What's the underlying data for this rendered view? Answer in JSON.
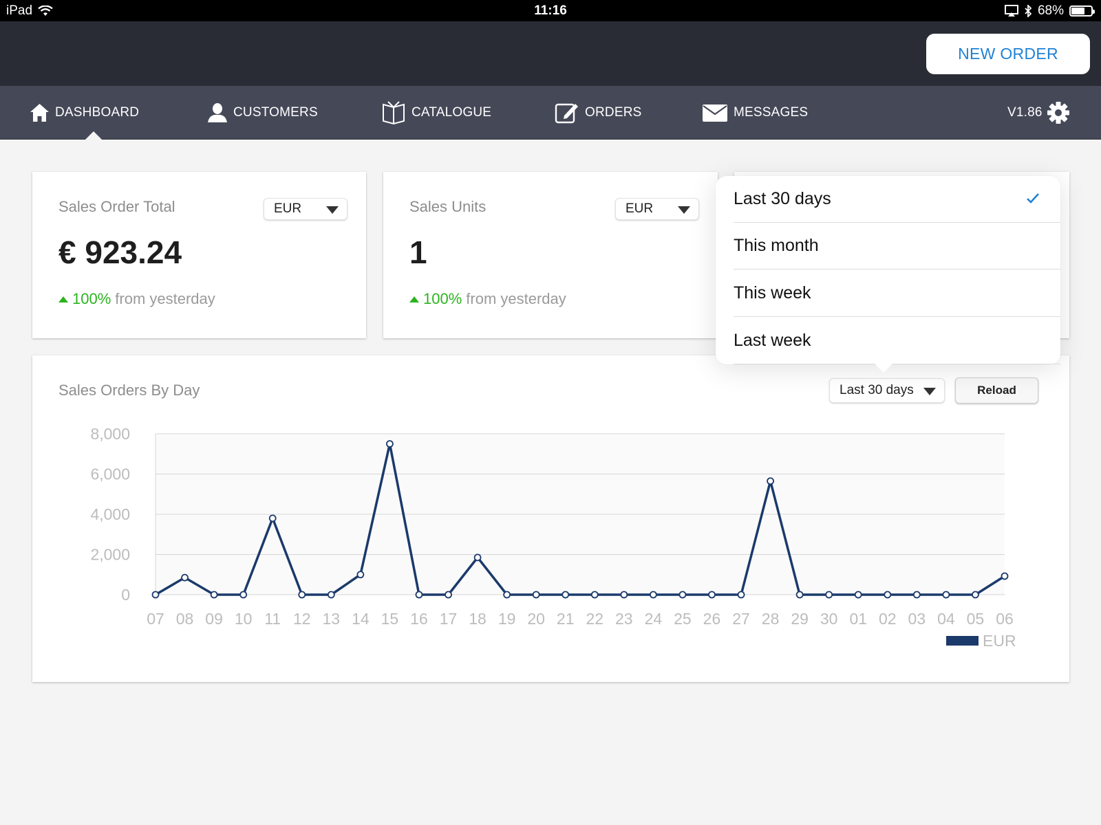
{
  "status_bar": {
    "device": "iPad",
    "time": "11:16",
    "battery": "68%",
    "battery_level": 0.68
  },
  "header": {
    "new_order_label": "NEW ORDER"
  },
  "nav": {
    "items": [
      {
        "label": "DASHBOARD",
        "icon": "home-icon"
      },
      {
        "label": "CUSTOMERS",
        "icon": "user-icon"
      },
      {
        "label": "CATALOGUE",
        "icon": "book-icon"
      },
      {
        "label": "ORDERS",
        "icon": "edit-icon"
      },
      {
        "label": "MESSAGES",
        "icon": "envelope-icon"
      }
    ],
    "version": "V1.86",
    "settings_icon": "gear-icon"
  },
  "cards": [
    {
      "title": "Sales Order Total",
      "currency": "EUR",
      "value": "€ 923.24",
      "change_pct": "100%",
      "change_text": "from yesterday"
    },
    {
      "title": "Sales Units",
      "currency": "EUR",
      "value": "1",
      "change_pct": "100%",
      "change_text": "from yesterday"
    }
  ],
  "chart_panel": {
    "title": "Sales Orders By Day",
    "range_select": "Last 30 days",
    "reload_label": "Reload"
  },
  "dropdown": {
    "options": [
      "Last 30 days",
      "This month",
      "This week",
      "Last week"
    ],
    "selected": "Last 30 days"
  },
  "colors": {
    "accent": "#1f82d6",
    "positive": "#2bb31e",
    "series": "#1b3a6b",
    "nav_bg": "#454857",
    "header_bg": "#2a2c35"
  },
  "chart_data": {
    "type": "line",
    "title": "Sales Orders By Day",
    "categories": [
      "07",
      "08",
      "09",
      "10",
      "11",
      "12",
      "13",
      "14",
      "15",
      "16",
      "17",
      "18",
      "19",
      "20",
      "21",
      "22",
      "23",
      "24",
      "25",
      "26",
      "27",
      "28",
      "29",
      "30",
      "01",
      "02",
      "03",
      "04",
      "05",
      "06"
    ],
    "series": [
      {
        "name": "EUR",
        "values": [
          0,
          850,
          0,
          0,
          3800,
          0,
          0,
          1000,
          7500,
          0,
          0,
          1850,
          0,
          0,
          0,
          0,
          0,
          0,
          0,
          0,
          0,
          5650,
          0,
          0,
          0,
          0,
          0,
          0,
          0,
          923
        ]
      }
    ],
    "yticks": [
      "0",
      "2,000",
      "4,000",
      "6,000",
      "8,000"
    ],
    "ylim": [
      0,
      8000
    ],
    "grid": true,
    "legend": "bottom-right"
  }
}
